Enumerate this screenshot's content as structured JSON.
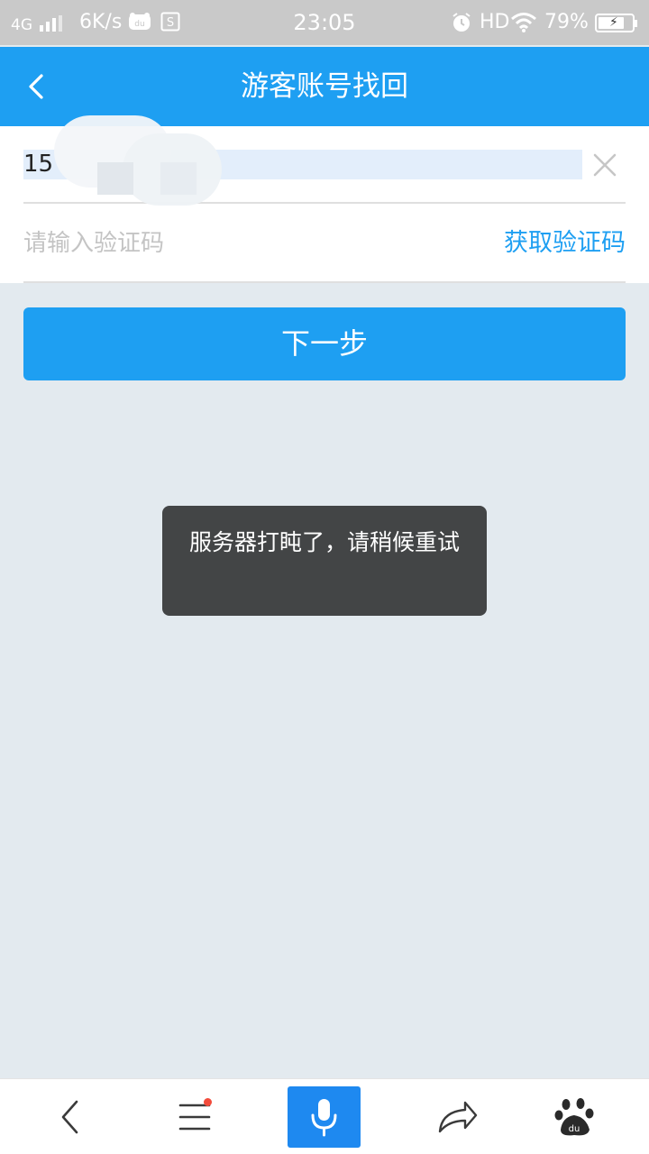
{
  "status_bar": {
    "network": "4G",
    "speed": "6K/s",
    "time": "23:05",
    "hd": "HD",
    "battery_pct": "79%",
    "battery_level": 0.79,
    "icons": [
      "signal-icon",
      "du-app-icon",
      "s-app-icon",
      "alarm-icon",
      "wifi-icon",
      "battery-charging-icon"
    ]
  },
  "header": {
    "title": "游客账号找回",
    "back_icon": "chevron-left-icon"
  },
  "form": {
    "phone_value": "15",
    "code_placeholder": "请输入验证码",
    "get_code_label": "获取验证码"
  },
  "next_button_label": "下一步",
  "toast": {
    "message": "服务器打盹了，请稍候重试"
  },
  "bottom_bar": {
    "items": [
      "back-icon",
      "menu-icon",
      "mic-icon",
      "share-icon",
      "baidu-paw-icon"
    ],
    "menu_has_badge": true
  },
  "colors": {
    "accent": "#1e9ff2",
    "mic_button": "#1e89f0",
    "background": "#e3eaef",
    "toast_bg": "#434546"
  }
}
